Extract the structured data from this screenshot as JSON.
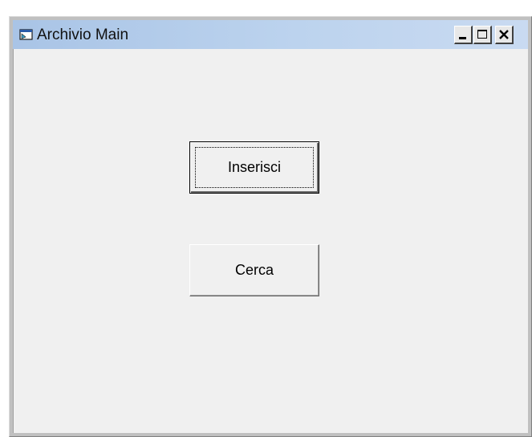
{
  "window": {
    "title": "Archivio Main",
    "title_icon": "form-icon",
    "caption_buttons": [
      "minimize-icon",
      "maximize-icon",
      "close-icon"
    ],
    "colors": {
      "titlebar_start": "#a9c4e6",
      "titlebar_end": "#c9daf1",
      "client_background": "#f0f0f0",
      "frame": "#c0c0c0"
    }
  },
  "form": {
    "buttons": {
      "inserisci_label": "Inserisci",
      "cerca_label": "Cerca"
    },
    "focused_button": "Inserisci"
  }
}
